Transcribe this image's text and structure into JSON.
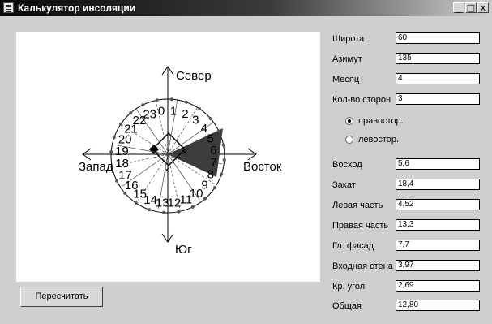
{
  "window": {
    "title": "Калькулятор инсоляции",
    "controls": {
      "minimize": "_",
      "maximize": "□",
      "close": "x"
    }
  },
  "diagram": {
    "directions": {
      "north": "Север",
      "south": "Юг",
      "west": "Запад",
      "east": "Восток"
    },
    "hours": [
      "0",
      "1",
      "2",
      "3",
      "4",
      "5",
      "6",
      "7",
      "8",
      "9",
      "10",
      "11",
      "12",
      "13",
      "14",
      "15",
      "16",
      "17",
      "18",
      "19",
      "20",
      "21",
      "22",
      "23"
    ]
  },
  "params": [
    {
      "label": "Широта",
      "value": "60"
    },
    {
      "label": "Азимут",
      "value": "135"
    },
    {
      "label": "Месяц",
      "value": "4"
    },
    {
      "label": "Кол-во сторон",
      "value": "3"
    }
  ],
  "orientation": {
    "options": [
      {
        "label": "правостор.",
        "checked": true
      },
      {
        "label": "левостор.",
        "checked": false
      }
    ]
  },
  "results": [
    {
      "label": "Восход",
      "value": "5,6"
    },
    {
      "label": "Закат",
      "value": "18,4"
    },
    {
      "label": "Левая часть",
      "value": "4,52"
    },
    {
      "label": "Правая часть",
      "value": "13,3"
    },
    {
      "label": "Гл. фасад",
      "value": "7,7"
    },
    {
      "label": "Входная стена",
      "value": "3,97"
    },
    {
      "label": "Кр. угол",
      "value": "2,69"
    },
    {
      "label": "Общая",
      "value": "12,80"
    }
  ],
  "actions": {
    "recalc_label": "Пересчитать"
  }
}
